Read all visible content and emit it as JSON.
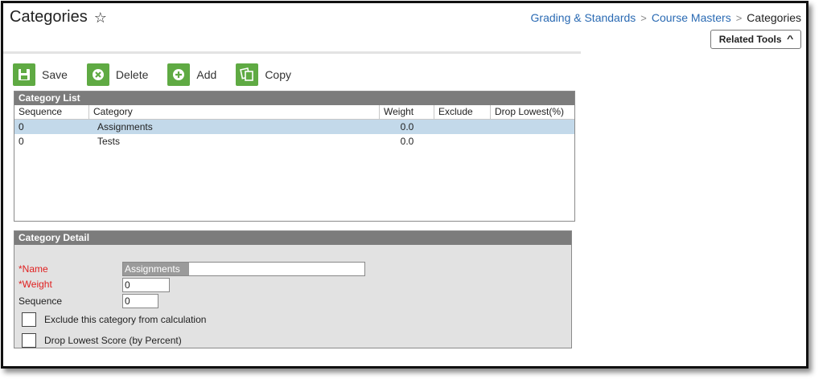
{
  "header": {
    "title": "Categories",
    "breadcrumb": [
      "Grading & Standards",
      "Course Masters",
      "Categories"
    ],
    "related_tools_label": "Related Tools"
  },
  "toolbar": {
    "save_label": "Save",
    "delete_label": "Delete",
    "add_label": "Add",
    "copy_label": "Copy"
  },
  "category_list": {
    "title": "Category List",
    "columns": [
      "Sequence",
      "Category",
      "Weight",
      "Exclude",
      "Drop Lowest(%)"
    ],
    "rows": [
      {
        "sequence": "0",
        "category": "Assignments",
        "weight": "0.0",
        "exclude": "",
        "drop_lowest": "",
        "selected": true
      },
      {
        "sequence": "0",
        "category": "Tests",
        "weight": "0.0",
        "exclude": "",
        "drop_lowest": "",
        "selected": false
      }
    ]
  },
  "category_detail": {
    "title": "Category Detail",
    "name_label": "*Name",
    "name_value": "Assignments",
    "weight_label": "*Weight",
    "weight_value": "0",
    "sequence_label": "Sequence",
    "sequence_value": "0",
    "exclude_label": "Exclude this category from calculation",
    "drop_lowest_label": "Drop Lowest Score (by Percent)"
  },
  "colors": {
    "accent_link": "#2a6ab3",
    "toolbar_green": "#5faa43",
    "panel_header": "#7c7c7c",
    "selected_row": "#c3d9ea",
    "required_red": "#e01f1f"
  },
  "icons": {
    "title": "star-icon",
    "related_tools": "chevron-up-icon",
    "save": "save-icon",
    "delete": "delete-icon",
    "add": "add-icon",
    "copy": "copy-icon",
    "breadcrumb_separator": "chevron-right-icon"
  }
}
